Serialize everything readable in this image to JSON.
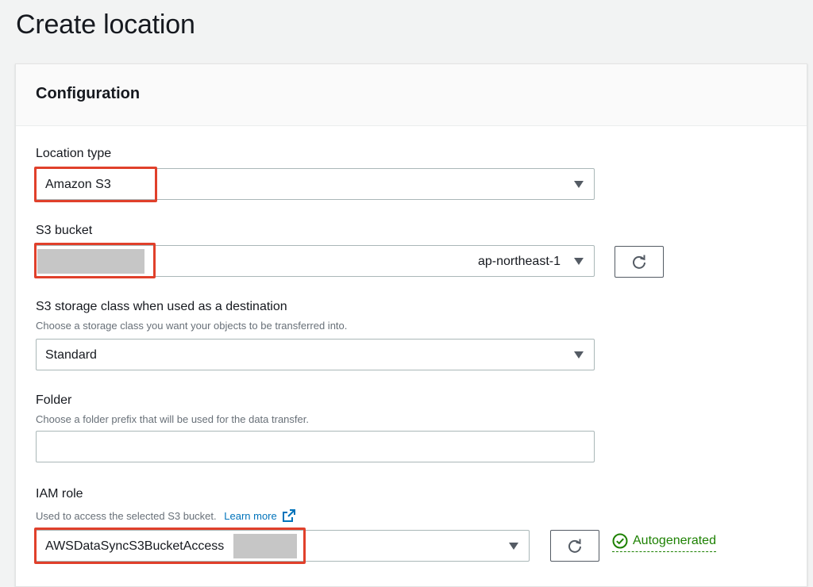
{
  "page": {
    "title": "Create location"
  },
  "panel": {
    "title": "Configuration"
  },
  "location_type": {
    "label": "Location type",
    "value": "Amazon S3"
  },
  "s3_bucket": {
    "label": "S3 bucket",
    "value": "",
    "region": "ap-northeast-1"
  },
  "storage_class": {
    "label": "S3 storage class when used as a destination",
    "description": "Choose a storage class you want your objects to be transferred into.",
    "value": "Standard"
  },
  "folder": {
    "label": "Folder",
    "description": "Choose a folder prefix that will be used for the data transfer.",
    "value": ""
  },
  "iam_role": {
    "label": "IAM role",
    "description": "Used to access the selected S3 bucket.",
    "learn_more": "Learn more",
    "value": "AWSDataSyncS3BucketAccess",
    "status": "Autogenerated"
  },
  "colors": {
    "highlight": "#e0402b",
    "link": "#0073bb",
    "success": "#1d8102"
  },
  "icons": {
    "dropdown": "caret-down-icon",
    "refresh": "refresh-icon",
    "external": "external-link-icon",
    "status": "check-circle-icon"
  }
}
